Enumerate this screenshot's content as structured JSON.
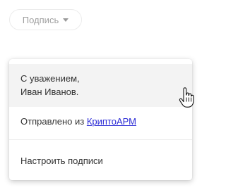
{
  "signature_button": {
    "label": "Подпись",
    "caret_icon": "caret-down-icon"
  },
  "menu": {
    "signature_item": {
      "line1": "С уважением,",
      "line2": "Иван Иванов."
    },
    "sent_item": {
      "prefix": "Отправлено из ",
      "link": "КриптоАРМ",
      "link_color": "#2b2bd6"
    },
    "settings_item": {
      "label": "Настроить подписи"
    }
  },
  "cursor_icon": "hand-pointer-icon"
}
